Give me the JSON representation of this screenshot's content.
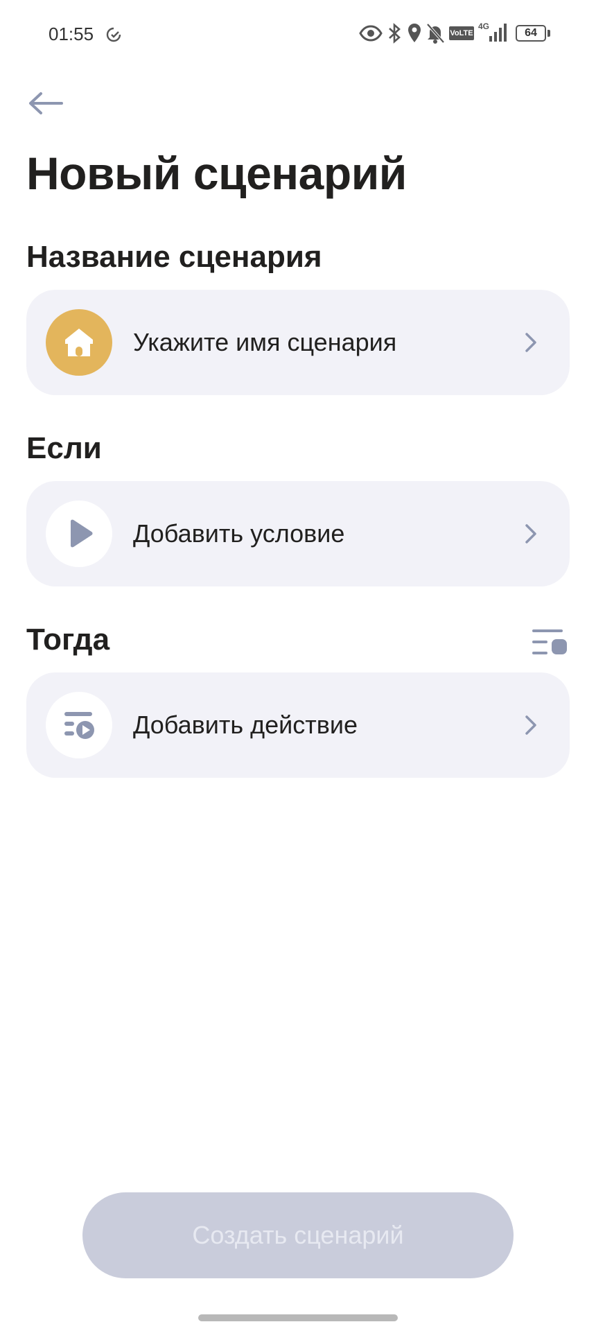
{
  "status_bar": {
    "time": "01:55",
    "battery": "64",
    "network": "4G",
    "volte": "VoLTE"
  },
  "header": {
    "title": "Новый сценарий"
  },
  "sections": {
    "name": {
      "title": "Название сценария",
      "card_label": "Укажите имя сценария",
      "icon": "home-icon",
      "icon_color": "#e3b55c"
    },
    "if": {
      "title": "Если",
      "card_label": "Добавить условие",
      "icon": "play-icon"
    },
    "then": {
      "title": "Тогда",
      "card_label": "Добавить действие",
      "icon": "action-list-icon"
    }
  },
  "footer": {
    "create_button_label": "Создать сценарий"
  },
  "colors": {
    "card_background": "#f2f2f8",
    "icon_muted": "#8d96b0",
    "button_disabled": "#c9ccdb"
  }
}
